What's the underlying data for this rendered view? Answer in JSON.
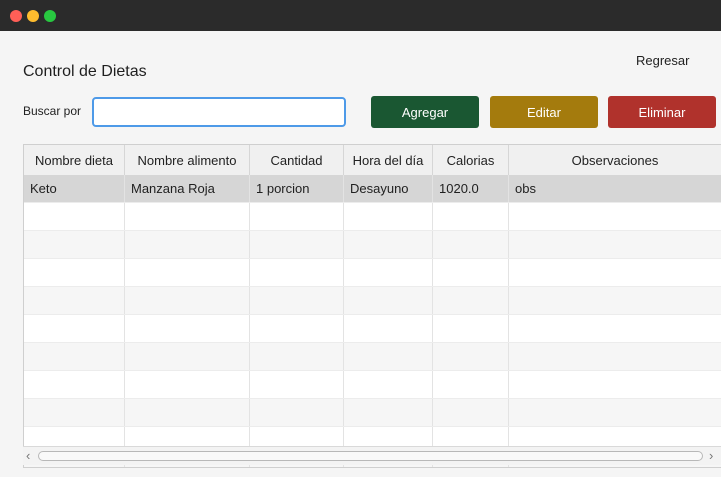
{
  "window": {
    "back_link": "Regresar",
    "title": "Control de Dietas"
  },
  "search": {
    "label": "Buscar por",
    "value": ""
  },
  "buttons": {
    "add": "Agregar",
    "edit": "Editar",
    "delete": "Eliminar"
  },
  "colors": {
    "add": "#1a5732",
    "edit": "#a47b0d",
    "delete": "#b0322c",
    "focus": "#4e9ae8"
  },
  "table": {
    "columns": [
      "Nombre dieta",
      "Nombre alimento",
      "Cantidad",
      "Hora del día",
      "Calorias",
      "Observaciones"
    ],
    "rows": [
      [
        "Keto",
        "Manzana Roja",
        "1 porcion",
        "Desayuno",
        "1020.0",
        "obs"
      ],
      [
        "",
        "",
        "",
        "",
        "",
        ""
      ],
      [
        "",
        "",
        "",
        "",
        "",
        ""
      ],
      [
        "",
        "",
        "",
        "",
        "",
        ""
      ],
      [
        "",
        "",
        "",
        "",
        "",
        ""
      ],
      [
        "",
        "",
        "",
        "",
        "",
        ""
      ],
      [
        "",
        "",
        "",
        "",
        "",
        ""
      ],
      [
        "",
        "",
        "",
        "",
        "",
        ""
      ],
      [
        "",
        "",
        "",
        "",
        "",
        ""
      ],
      [
        "",
        "",
        "",
        "",
        "",
        ""
      ],
      [
        "",
        "",
        "",
        "",
        "",
        ""
      ]
    ]
  },
  "scrollbar": {
    "left_arrow": "‹",
    "right_arrow": "›"
  }
}
